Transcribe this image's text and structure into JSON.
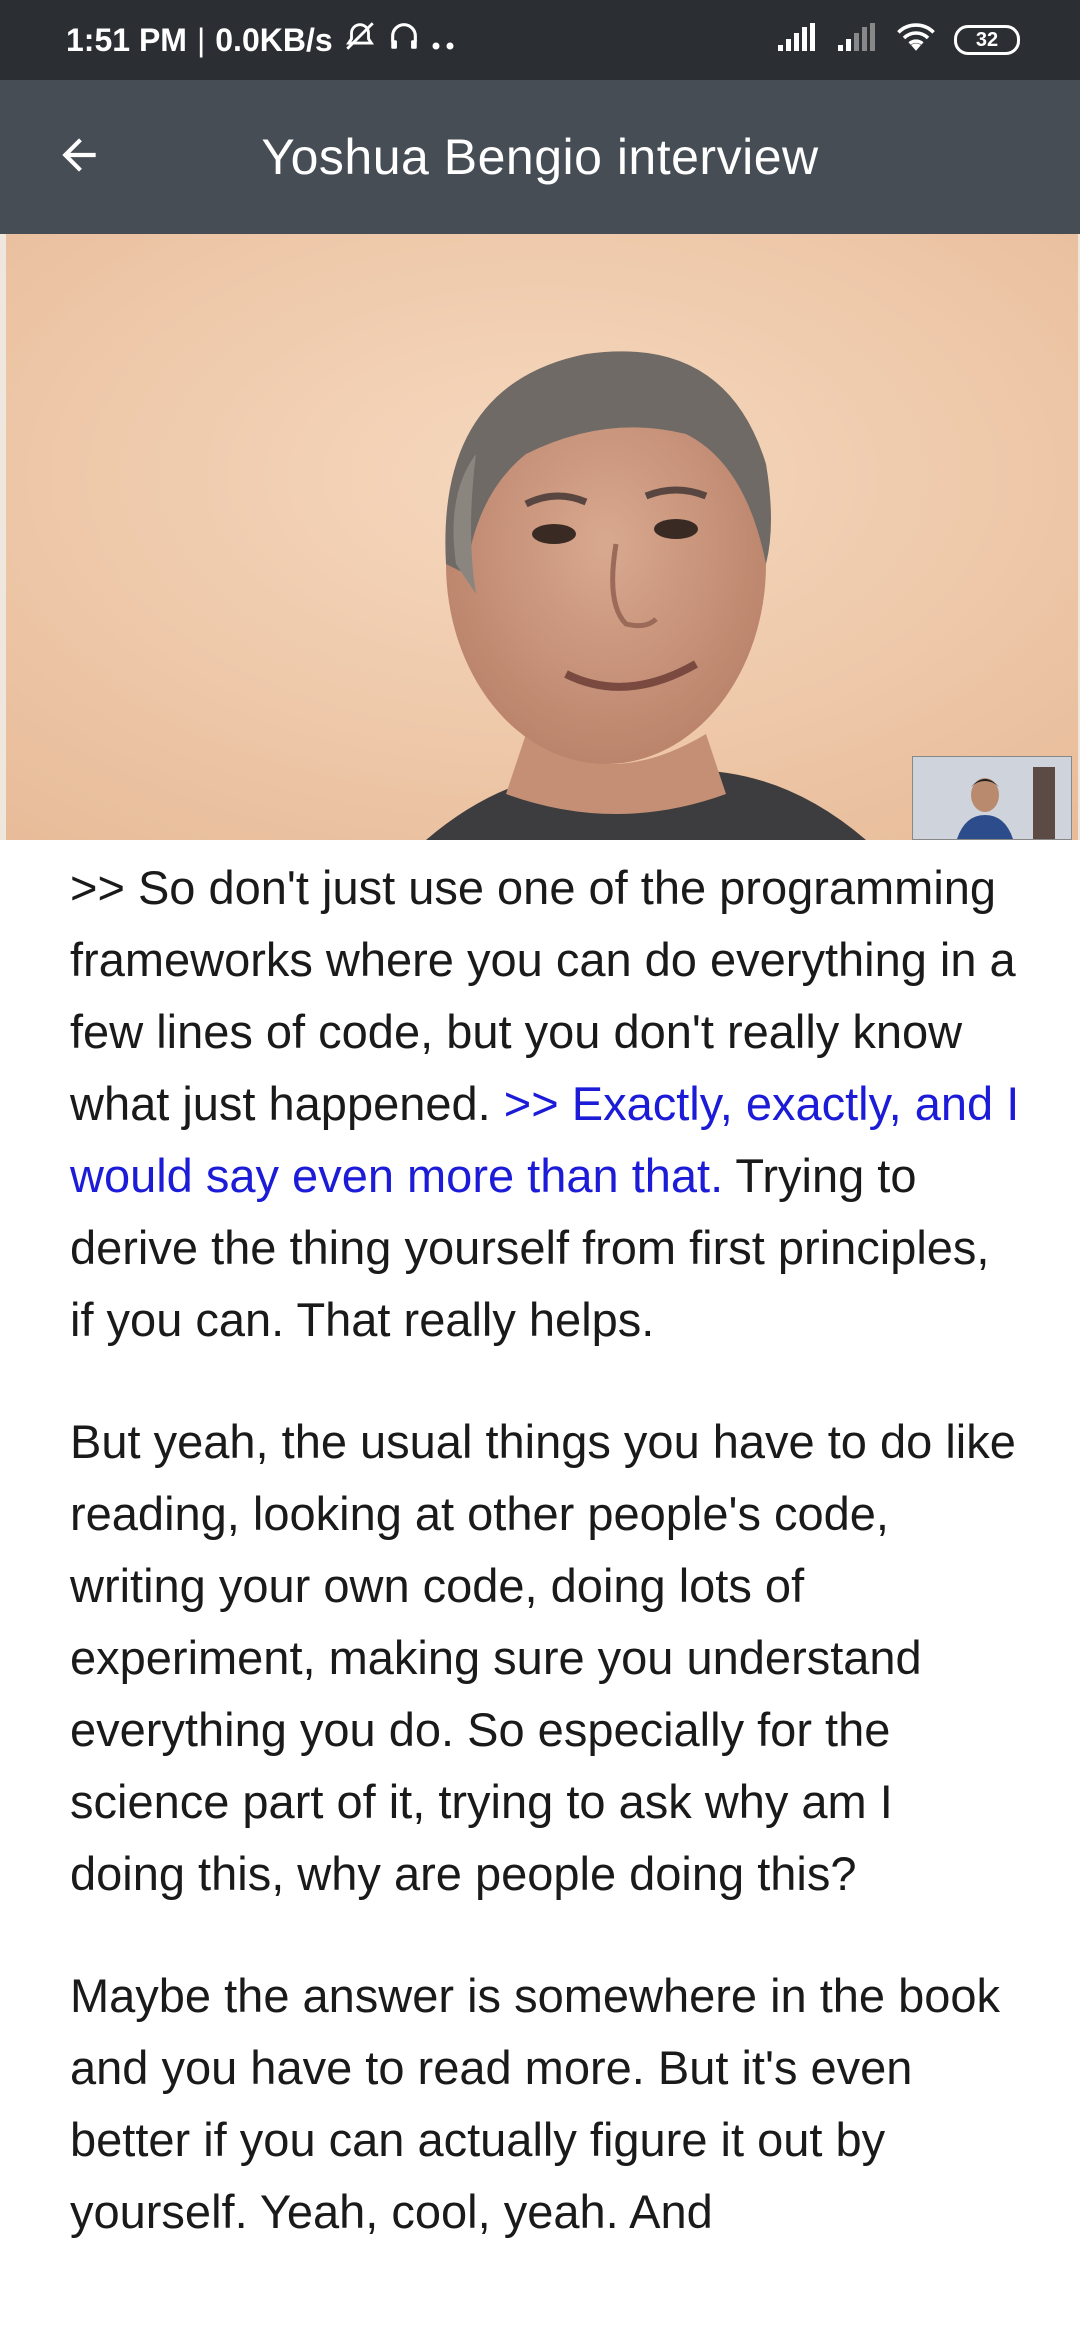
{
  "status_bar": {
    "time": "1:51 PM",
    "separator": "|",
    "speed": "0.0KB/s",
    "battery": "32",
    "icons": [
      "alarm-off-icon",
      "headphones-icon",
      "more-dots-icon",
      "signal-icon",
      "signal-weak-icon",
      "wifi-icon",
      "battery-icon"
    ]
  },
  "app_bar": {
    "title": "Yoshua Bengio interview",
    "back_icon": "arrow-left-icon"
  },
  "transcript": {
    "p1_start": ">> So don't just use one of the programming frameworks where you can do everything in a few lines of code, but you don't really know what just happened.",
    "p1_highlight": ">> Exactly, exactly, and I would say even more than that.",
    "p1_end": " Trying to derive the thing yourself from first principles, if you can. That really helps.",
    "p2": "But yeah, the usual things you have to do like reading, looking at other people's code, writing your own code, doing lots of experiment, making sure you understand everything you do. So especially for the science part of it, trying to ask why am I doing this, why are people doing this?",
    "p3": "Maybe the answer is somewhere in the book and you have to read more. But it's even better if you can actually figure it out by yourself. Yeah, cool, yeah. And"
  },
  "colors": {
    "status_bar_bg": "#2b2f34",
    "app_bar_bg": "#474d55",
    "highlight_text": "#1b1bd8"
  }
}
